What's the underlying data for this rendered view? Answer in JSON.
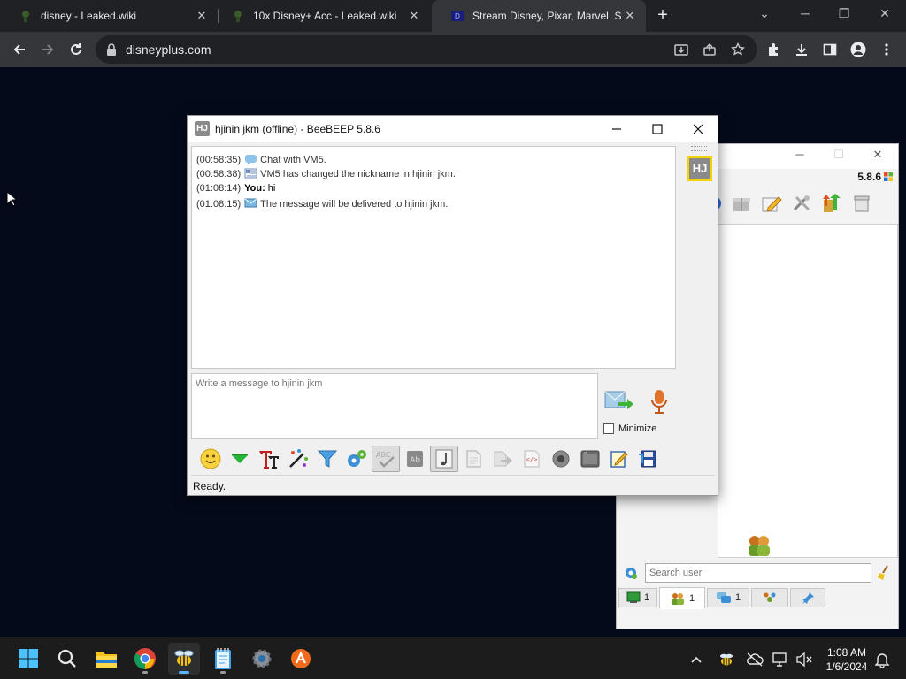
{
  "browser": {
    "tabs": [
      {
        "title": "disney - Leaked.wiki",
        "active": false
      },
      {
        "title": "10x Disney+ Acc - Leaked.wiki",
        "active": false
      },
      {
        "title": "Stream Disney, Pixar, Marvel, Sta",
        "active": true
      }
    ],
    "url": "disneyplus.com",
    "icons": [
      "back-icon",
      "forward-icon",
      "reload-icon",
      "lock-icon",
      "install-icon",
      "share-icon",
      "star-icon",
      "extensions-icon",
      "download-icon",
      "sidepanel-icon",
      "profile-icon",
      "menu-icon"
    ]
  },
  "main_window": {
    "version": "5.8.6",
    "search_placeholder": "Search user",
    "tabs": [
      {
        "icon": "green-screen-icon",
        "count": "1"
      },
      {
        "icon": "users-icon",
        "count": "1"
      },
      {
        "icon": "chats-icon",
        "count": "1"
      },
      {
        "icon": "groups-icon",
        "count": ""
      },
      {
        "icon": "pin-icon",
        "count": ""
      }
    ]
  },
  "chat_window": {
    "title": "hjinin jkm (offline) - BeeBEEP 5.8.6",
    "app_icon_text": "HJ",
    "avatar_text": "HJ",
    "messages": [
      {
        "time": "(00:58:35)",
        "icon": "chat-bubble-icon",
        "sender": "",
        "text": "Chat with VM5."
      },
      {
        "time": "(00:58:38)",
        "icon": "card-icon",
        "sender": "",
        "text": "VM5 has changed the nickname in hjinin jkm."
      },
      {
        "time": "(01:08:14)",
        "icon": "",
        "sender": "You:",
        "text": "hi"
      },
      {
        "time": "(01:08:15)",
        "icon": "envelope-icon",
        "sender": "",
        "text": "The message will be delivered to hjinin jkm."
      }
    ],
    "compose_placeholder": "Write a message to hjinin jkm",
    "minimize_label": "Minimize",
    "status": "Ready."
  },
  "taskbar": {
    "time": "1:08 AM",
    "date": "1/6/2024"
  },
  "colors": {
    "desktop": "#040a1a",
    "chrome_tabstrip": "#1f2124",
    "chrome_toolbar": "#35363a",
    "taskbar": "#1c1c1c",
    "avatar_border": "#f2d200"
  }
}
